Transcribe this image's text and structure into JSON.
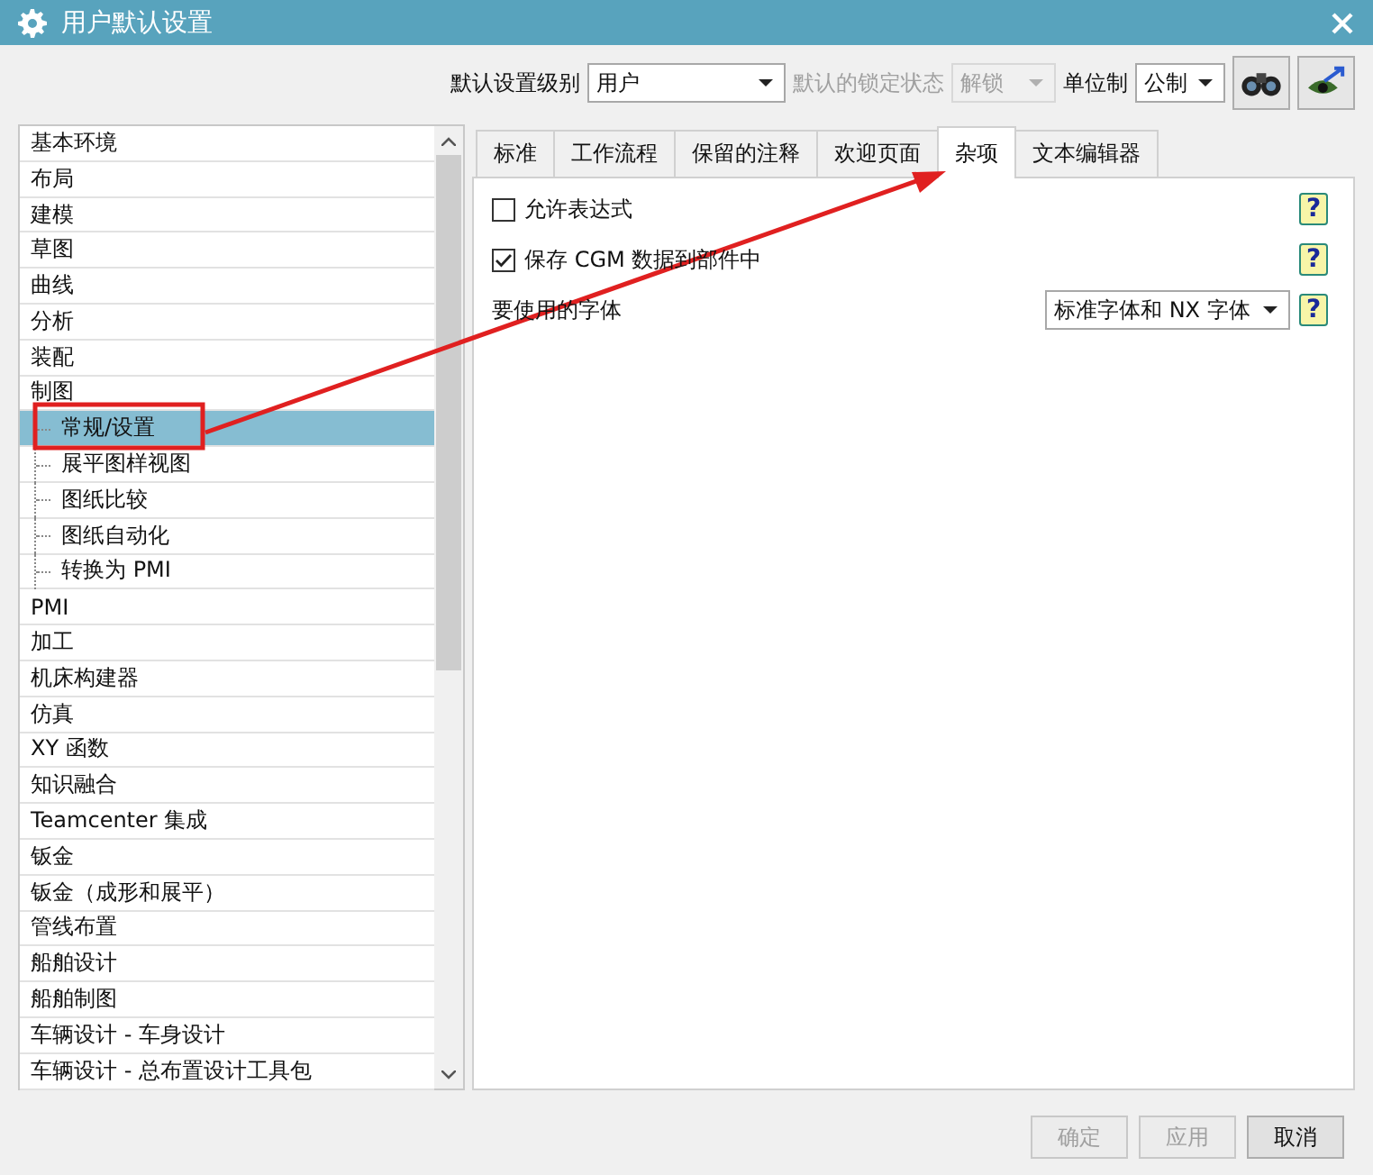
{
  "window": {
    "title": "用户默认设置"
  },
  "toolbar": {
    "level_label": "默认设置级别",
    "level_value": "用户",
    "lock_label": "默认的锁定状态",
    "lock_value": "解锁",
    "lock_disabled": true,
    "unit_label": "单位制",
    "unit_value": "公制"
  },
  "categories": [
    {
      "label": "基本环境",
      "selected": false
    },
    {
      "label": "布局",
      "selected": false
    },
    {
      "label": "建模",
      "selected": false
    },
    {
      "label": "草图",
      "selected": false
    },
    {
      "label": "曲线",
      "selected": false
    },
    {
      "label": "分析",
      "selected": false
    },
    {
      "label": "装配",
      "selected": false
    },
    {
      "label": "制图",
      "selected": false,
      "expanded": true,
      "children": [
        {
          "label": "常规/设置",
          "selected": true
        },
        {
          "label": "展平图样视图",
          "selected": false
        },
        {
          "label": "图纸比较",
          "selected": false
        },
        {
          "label": "图纸自动化",
          "selected": false
        },
        {
          "label": "转换为 PMI",
          "selected": false
        }
      ]
    },
    {
      "label": "PMI",
      "selected": false
    },
    {
      "label": "加工",
      "selected": false
    },
    {
      "label": "机床构建器",
      "selected": false
    },
    {
      "label": "仿真",
      "selected": false
    },
    {
      "label": "XY 函数",
      "selected": false
    },
    {
      "label": "知识融合",
      "selected": false
    },
    {
      "label": "Teamcenter 集成",
      "selected": false
    },
    {
      "label": "钣金",
      "selected": false
    },
    {
      "label": "钣金（成形和展平）",
      "selected": false
    },
    {
      "label": "管线布置",
      "selected": false
    },
    {
      "label": "船舶设计",
      "selected": false
    },
    {
      "label": "船舶制图",
      "selected": false
    },
    {
      "label": "车辆设计 - 车身设计",
      "selected": false
    },
    {
      "label": "车辆设计 - 总布置设计工具包",
      "selected": false
    }
  ],
  "tabs": [
    {
      "label": "标准",
      "selected": false
    },
    {
      "label": "工作流程",
      "selected": false
    },
    {
      "label": "保留的注释",
      "selected": false
    },
    {
      "label": "欢迎页面",
      "selected": false
    },
    {
      "label": "杂项",
      "selected": true
    },
    {
      "label": "文本编辑器",
      "selected": false
    }
  ],
  "options": [
    {
      "kind": "checkbox",
      "label": "允许表达式",
      "checked": false,
      "help": "?"
    },
    {
      "kind": "checkbox",
      "label": "保存 CGM 数据到部件中",
      "checked": true,
      "help": "?"
    },
    {
      "kind": "dropdown",
      "label": "要使用的字体",
      "value": "标准字体和 NX 字体",
      "help": "?"
    }
  ],
  "buttons": [
    {
      "label": "确定",
      "disabled": true
    },
    {
      "label": "应用",
      "disabled": true
    },
    {
      "label": "取消",
      "disabled": false
    }
  ]
}
